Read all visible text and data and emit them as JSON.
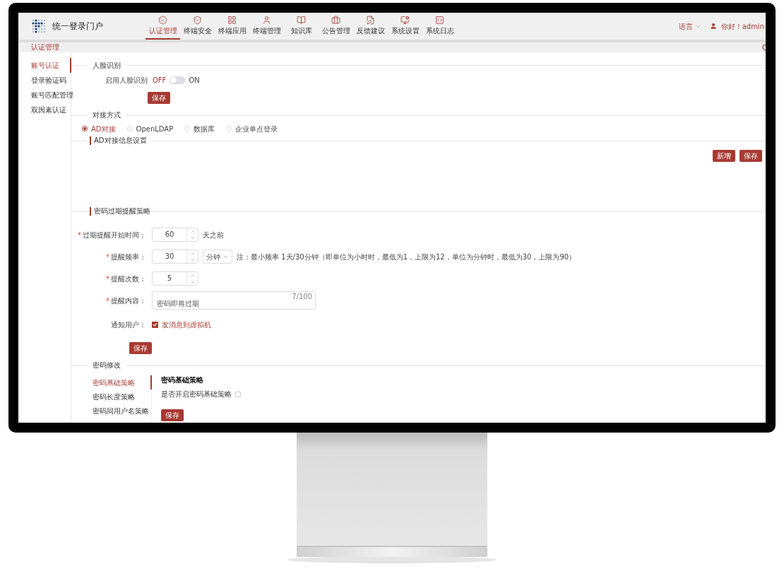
{
  "app": {
    "title": "统一登录门户"
  },
  "nav": [
    {
      "label": "认证管理",
      "selected": true
    },
    {
      "label": "终端安全",
      "selected": false
    },
    {
      "label": "终端应用",
      "selected": false
    },
    {
      "label": "终端管理",
      "selected": false
    },
    {
      "label": "知识库",
      "selected": false
    },
    {
      "label": "公告管理",
      "selected": false
    },
    {
      "label": "反馈建议",
      "selected": false
    },
    {
      "label": "系统设置",
      "selected": false
    },
    {
      "label": "系统日志",
      "selected": false
    }
  ],
  "header_right": {
    "language": "语言",
    "greeting": "你好！admin"
  },
  "breadcrumb": "认证管理",
  "sidebar": [
    {
      "label": "账号认证",
      "selected": true
    },
    {
      "label": "登录验证码",
      "selected": false
    },
    {
      "label": "账号匹配管理",
      "selected": false
    },
    {
      "label": "双因素认证",
      "selected": false
    }
  ],
  "face": {
    "section": "人脸识别",
    "label": "启用人脸识别",
    "off_label": "OFF",
    "on_label": "ON",
    "on": false,
    "save": "保存"
  },
  "docking": {
    "section": "对接方式",
    "options": [
      {
        "label": "AD对接",
        "selected": true
      },
      {
        "label": "OpenLDAP",
        "selected": false
      },
      {
        "label": "数据库",
        "selected": false
      },
      {
        "label": "企业单点登录",
        "selected": false
      }
    ],
    "subsection": "AD对接信息设置",
    "buttons": [
      "新增",
      "保存"
    ]
  },
  "expiry": {
    "section": "密码过期提醒策略",
    "fields": [
      {
        "kind": "number",
        "label": "过期提醒开始时间：",
        "required_mark": "*",
        "value": "60",
        "suffix": "天之前"
      },
      {
        "kind": "number",
        "label": "提醒频率：",
        "required_mark": "*",
        "value": "30",
        "unit": "分钟",
        "note": "注：最小频率 1天/30分钟（即单位为小时时，最低为1，上限为12，单位为分钟时，最低为30，上限为90）"
      },
      {
        "kind": "number",
        "label": "提醒次数：",
        "required_mark": "*",
        "value": "5"
      },
      {
        "kind": "textarea",
        "label": "提醒内容：",
        "required_mark": "*",
        "value": "密码即将过期",
        "count": "7/100"
      },
      {
        "kind": "checkbox",
        "label": "通知用户：",
        "option": "发消息到虚拟机",
        "checked": true
      }
    ],
    "save": "保存"
  },
  "password": {
    "section": "密码修改",
    "tabs": [
      {
        "label": "密码基础策略",
        "selected": true
      },
      {
        "label": "密码长度策略",
        "selected": false
      },
      {
        "label": "密码同用户名策略",
        "selected": false
      }
    ],
    "panel": {
      "title": "密码基础策略",
      "option": "是否开启密码基础策略",
      "checked": false,
      "save": "保存"
    }
  }
}
